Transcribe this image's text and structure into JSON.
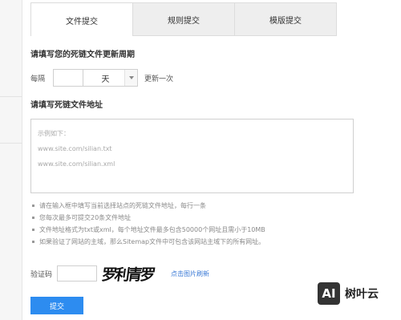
{
  "tabs": [
    {
      "label": "文件提交",
      "active": true
    },
    {
      "label": "规则提交",
      "active": false
    },
    {
      "label": "模版提交",
      "active": false
    }
  ],
  "period_section": {
    "heading": "请填写您的死链文件更新周期",
    "prefix": "每隔",
    "input_value": "",
    "unit": "天",
    "suffix": "更新一次"
  },
  "url_section": {
    "heading": "请填写死链文件地址",
    "placeholder_lines": [
      "示例如下：",
      "www.site.com/silian.txt",
      "www.site.com/silian.xml"
    ]
  },
  "notes": [
    "请在输入框中填写当前选择站点的死链文件地址，每行一条",
    "您每次最多可提交20条文件地址",
    "文件地址格式为txt或xml，每个地址文件最多包含50000个网址且需小于10MB",
    "如果验证了网站的主域，那么Sitemap文件中可包含该网站主域下的所有网址。"
  ],
  "captcha": {
    "label": "验证码",
    "input_value": "",
    "image_text": "罗利青罗",
    "refresh_label": "点击图片刷新"
  },
  "submit_label": "提交",
  "watermark": {
    "logo_text": "AI",
    "brand_text": "树叶云"
  },
  "colors": {
    "primary": "#2d8cf0",
    "link": "#3a79d6"
  }
}
